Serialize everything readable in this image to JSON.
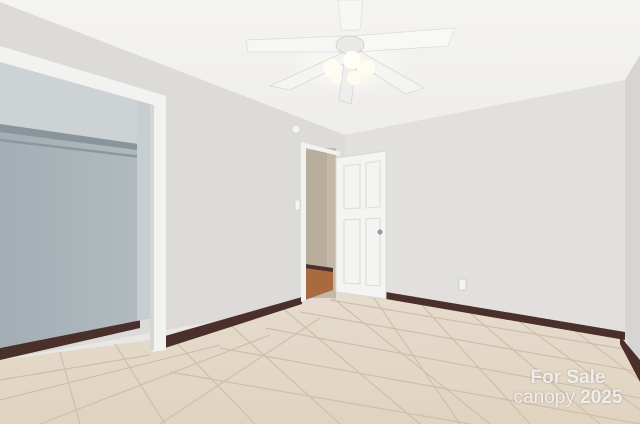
{
  "photo": {
    "scene": "empty-bedroom",
    "colors": {
      "ceiling": "#f1f0ee",
      "wall_left": "#dcdbd9",
      "wall_back": "#e1e0de",
      "wall_right": "#d6d5d3",
      "closet_interior": "#a9b3b8",
      "baseboard": "#4a2f2a",
      "floor_tile": "#e2d6c5",
      "grout": "#cdbfac",
      "door": "#f4f4f2",
      "hall_floor": "#a86a3e"
    }
  },
  "watermark": {
    "line1": "For Sale",
    "brand": "canopy",
    "year": "2025"
  }
}
